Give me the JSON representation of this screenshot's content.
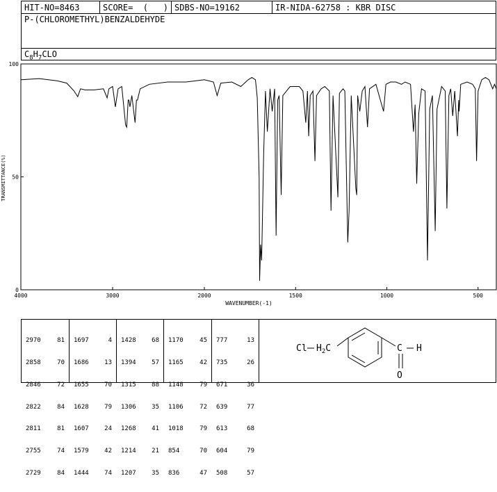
{
  "header": {
    "hit_no": "HIT-NO=8463",
    "score": "SCORE=  (   )",
    "sdbs_no": "SDBS-NO=19162",
    "ir_nida": "IR-NIDA-62758 : KBR DISC",
    "compound_name": "P-(CHLOROMETHYL)BENZALDEHYDE",
    "formula_parts": [
      "C",
      "8",
      "H",
      "7",
      "CLO"
    ]
  },
  "chart_data": {
    "type": "line",
    "xlabel": "WAVENUMBER(-1)",
    "ylabel": "TRANSMITTANCE(%)",
    "xlim": [
      4000,
      400
    ],
    "ylim": [
      0,
      100
    ],
    "x_ticks": [
      "4000",
      "3000",
      "2000",
      "1500",
      "1000",
      "500"
    ],
    "y_ticks": [
      "100",
      "50",
      "0"
    ],
    "series": [
      {
        "points": [
          [
            4000,
            93
          ],
          [
            3800,
            93.5
          ],
          [
            3600,
            92.5
          ],
          [
            3500,
            91.5
          ],
          [
            3420,
            88
          ],
          [
            3380,
            85.5
          ],
          [
            3350,
            89
          ],
          [
            3300,
            88.5
          ],
          [
            3200,
            88.5
          ],
          [
            3100,
            89
          ],
          [
            3060,
            85
          ],
          [
            3040,
            89
          ],
          [
            3000,
            90
          ],
          [
            2970,
            81
          ],
          [
            2940,
            89
          ],
          [
            2900,
            90
          ],
          [
            2858,
            73
          ],
          [
            2846,
            72
          ],
          [
            2830,
            84
          ],
          [
            2822,
            84
          ],
          [
            2811,
            81
          ],
          [
            2790,
            86
          ],
          [
            2755,
            74
          ],
          [
            2740,
            84
          ],
          [
            2729,
            84
          ],
          [
            2700,
            89
          ],
          [
            2600,
            91
          ],
          [
            2400,
            92
          ],
          [
            2300,
            92
          ],
          [
            2200,
            92
          ],
          [
            2100,
            92.5
          ],
          [
            2000,
            93
          ],
          [
            1950,
            92
          ],
          [
            1930,
            86
          ],
          [
            1910,
            91.5
          ],
          [
            1850,
            92
          ],
          [
            1800,
            90
          ],
          [
            1760,
            93
          ],
          [
            1740,
            94
          ],
          [
            1720,
            93
          ],
          [
            1710,
            85
          ],
          [
            1700,
            50
          ],
          [
            1697,
            4
          ],
          [
            1692,
            20
          ],
          [
            1686,
            13
          ],
          [
            1675,
            60
          ],
          [
            1665,
            88
          ],
          [
            1655,
            70
          ],
          [
            1640,
            89
          ],
          [
            1628,
            79
          ],
          [
            1615,
            89
          ],
          [
            1607,
            24
          ],
          [
            1598,
            84
          ],
          [
            1590,
            86
          ],
          [
            1579,
            42
          ],
          [
            1570,
            86
          ],
          [
            1530,
            90
          ],
          [
            1480,
            90
          ],
          [
            1460,
            88
          ],
          [
            1444,
            74
          ],
          [
            1435,
            88
          ],
          [
            1428,
            68
          ],
          [
            1420,
            86
          ],
          [
            1405,
            88
          ],
          [
            1394,
            57
          ],
          [
            1385,
            86
          ],
          [
            1360,
            89
          ],
          [
            1340,
            90
          ],
          [
            1315,
            88
          ],
          [
            1306,
            35
          ],
          [
            1295,
            86
          ],
          [
            1268,
            41
          ],
          [
            1260,
            87
          ],
          [
            1240,
            89
          ],
          [
            1230,
            88
          ],
          [
            1214,
            21
          ],
          [
            1207,
            35
          ],
          [
            1195,
            86
          ],
          [
            1170,
            45
          ],
          [
            1165,
            42
          ],
          [
            1160,
            86
          ],
          [
            1148,
            79
          ],
          [
            1135,
            88
          ],
          [
            1120,
            90
          ],
          [
            1106,
            72
          ],
          [
            1095,
            89
          ],
          [
            1060,
            91
          ],
          [
            1018,
            79
          ],
          [
            1005,
            91
          ],
          [
            980,
            92
          ],
          [
            950,
            92
          ],
          [
            920,
            91
          ],
          [
            900,
            92
          ],
          [
            870,
            91
          ],
          [
            854,
            70
          ],
          [
            845,
            82
          ],
          [
            836,
            47
          ],
          [
            825,
            78
          ],
          [
            810,
            89
          ],
          [
            790,
            88
          ],
          [
            777,
            13
          ],
          [
            765,
            80
          ],
          [
            750,
            86
          ],
          [
            735,
            26
          ],
          [
            725,
            80
          ],
          [
            700,
            90
          ],
          [
            680,
            88
          ],
          [
            671,
            36
          ],
          [
            660,
            86
          ],
          [
            650,
            89
          ],
          [
            639,
            77
          ],
          [
            628,
            88
          ],
          [
            613,
            68
          ],
          [
            606,
            84
          ],
          [
            604,
            79
          ],
          [
            595,
            91
          ],
          [
            560,
            92
          ],
          [
            530,
            91
          ],
          [
            515,
            89
          ],
          [
            508,
            57
          ],
          [
            500,
            88
          ],
          [
            480,
            93
          ],
          [
            460,
            94
          ],
          [
            440,
            93
          ],
          [
            420,
            89
          ],
          [
            410,
            91
          ],
          [
            400,
            89
          ]
        ]
      }
    ]
  },
  "peaks": [
    [
      [
        "2970",
        "81"
      ],
      [
        "2858",
        "70"
      ],
      [
        "2846",
        "72"
      ],
      [
        "2822",
        "84"
      ],
      [
        "2811",
        "81"
      ],
      [
        "2755",
        "74"
      ],
      [
        "2729",
        "84"
      ]
    ],
    [
      [
        "1697",
        "4"
      ],
      [
        "1686",
        "13"
      ],
      [
        "1655",
        "70"
      ],
      [
        "1628",
        "79"
      ],
      [
        "1607",
        "24"
      ],
      [
        "1579",
        "42"
      ],
      [
        "1444",
        "74"
      ]
    ],
    [
      [
        "1428",
        "68"
      ],
      [
        "1394",
        "57"
      ],
      [
        "1315",
        "88"
      ],
      [
        "1306",
        "35"
      ],
      [
        "1268",
        "41"
      ],
      [
        "1214",
        "21"
      ],
      [
        "1207",
        "35"
      ]
    ],
    [
      [
        "1170",
        "45"
      ],
      [
        "1165",
        "42"
      ],
      [
        "1148",
        "79"
      ],
      [
        "1106",
        "72"
      ],
      [
        "1018",
        "79"
      ],
      [
        "854",
        "70"
      ],
      [
        "836",
        "47"
      ]
    ],
    [
      [
        "777",
        "13"
      ],
      [
        "735",
        "26"
      ],
      [
        "671",
        "36"
      ],
      [
        "639",
        "77"
      ],
      [
        "613",
        "68"
      ],
      [
        "604",
        "79"
      ],
      [
        "508",
        "57"
      ]
    ]
  ],
  "structure": {
    "cl": "Cl",
    "h2c": "H",
    "h2c_sub": "2",
    "h2c_c": "C",
    "c": "C",
    "h": "H",
    "o": "O"
  }
}
